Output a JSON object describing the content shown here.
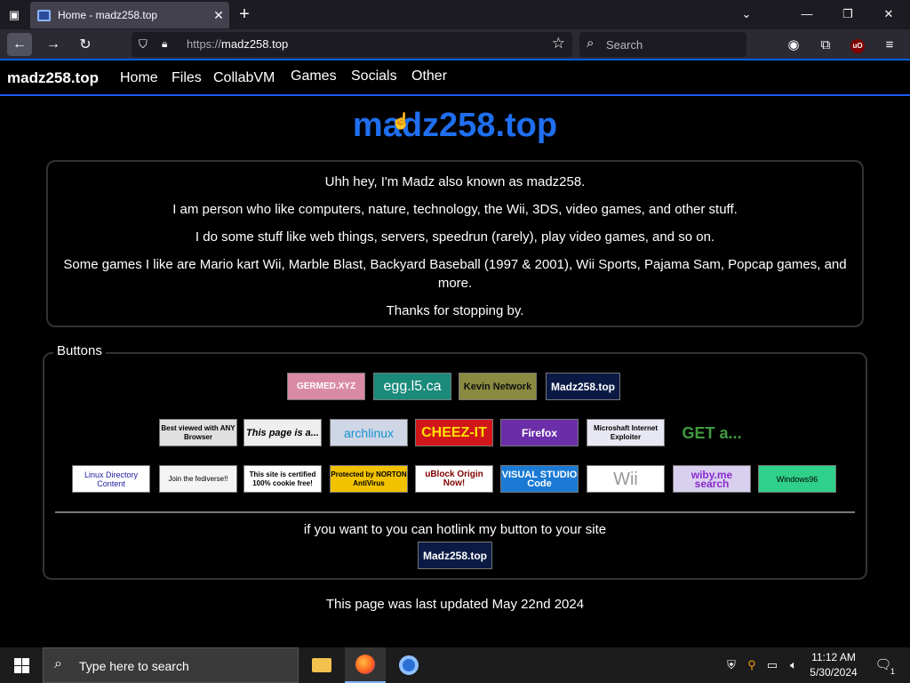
{
  "browser": {
    "tab_title": "Home - madz258.top",
    "url_protocol": "https://",
    "url_host": "madz258.top",
    "search_placeholder": "Search"
  },
  "site": {
    "brand": "madz258.top",
    "nav": [
      "Home",
      "Files",
      "CollabVM",
      "Games",
      "Socials",
      "Other"
    ],
    "hero_title": "madz258.top",
    "about": [
      "Uhh hey, I'm Madz also known as madz258.",
      "I am person who like computers, nature, technology, the Wii, 3DS, video games, and other stuff.",
      "I do some stuff like web things, servers, speedrun (rarely), play video games, and so on.",
      "Some games I like are Mario kart Wii, Marble Blast, Backyard Baseball (1997 & 2001), Wii Sports, Pajama Sam, Popcap games, and more.",
      "Thanks for stopping by."
    ],
    "buttons_heading": "Buttons",
    "buttons_row1": [
      "GERMED.XYZ",
      "egg.l5.ca",
      "Kevin Network",
      "Madz258.top"
    ],
    "buttons_row2": [
      "Best viewed with ANY Browser",
      "This page is a...",
      "archlinux",
      "CHEEZ-IT",
      "Firefox",
      "Microshaft Internet Exploiter",
      "GET a..."
    ],
    "buttons_row3": [
      "Linux Directory Content",
      "Join the fediverse!!",
      "This site is certified 100% cookie free!",
      "Protected by NORTON AntiVirus",
      "uBlock Origin Now!",
      "VISUAL STUDIO Code",
      "Wii",
      "wiby.me search",
      "Windows96"
    ],
    "hotlink_text": "if you want to you can hotlink my button to your site",
    "hotlink_button": "Madz258.top",
    "footer": "This page was last updated May 22nd 2024"
  },
  "taskbar": {
    "search_placeholder": "Type here to search",
    "time": "11:12 AM",
    "date": "5/30/2024",
    "notification_count": "1"
  }
}
